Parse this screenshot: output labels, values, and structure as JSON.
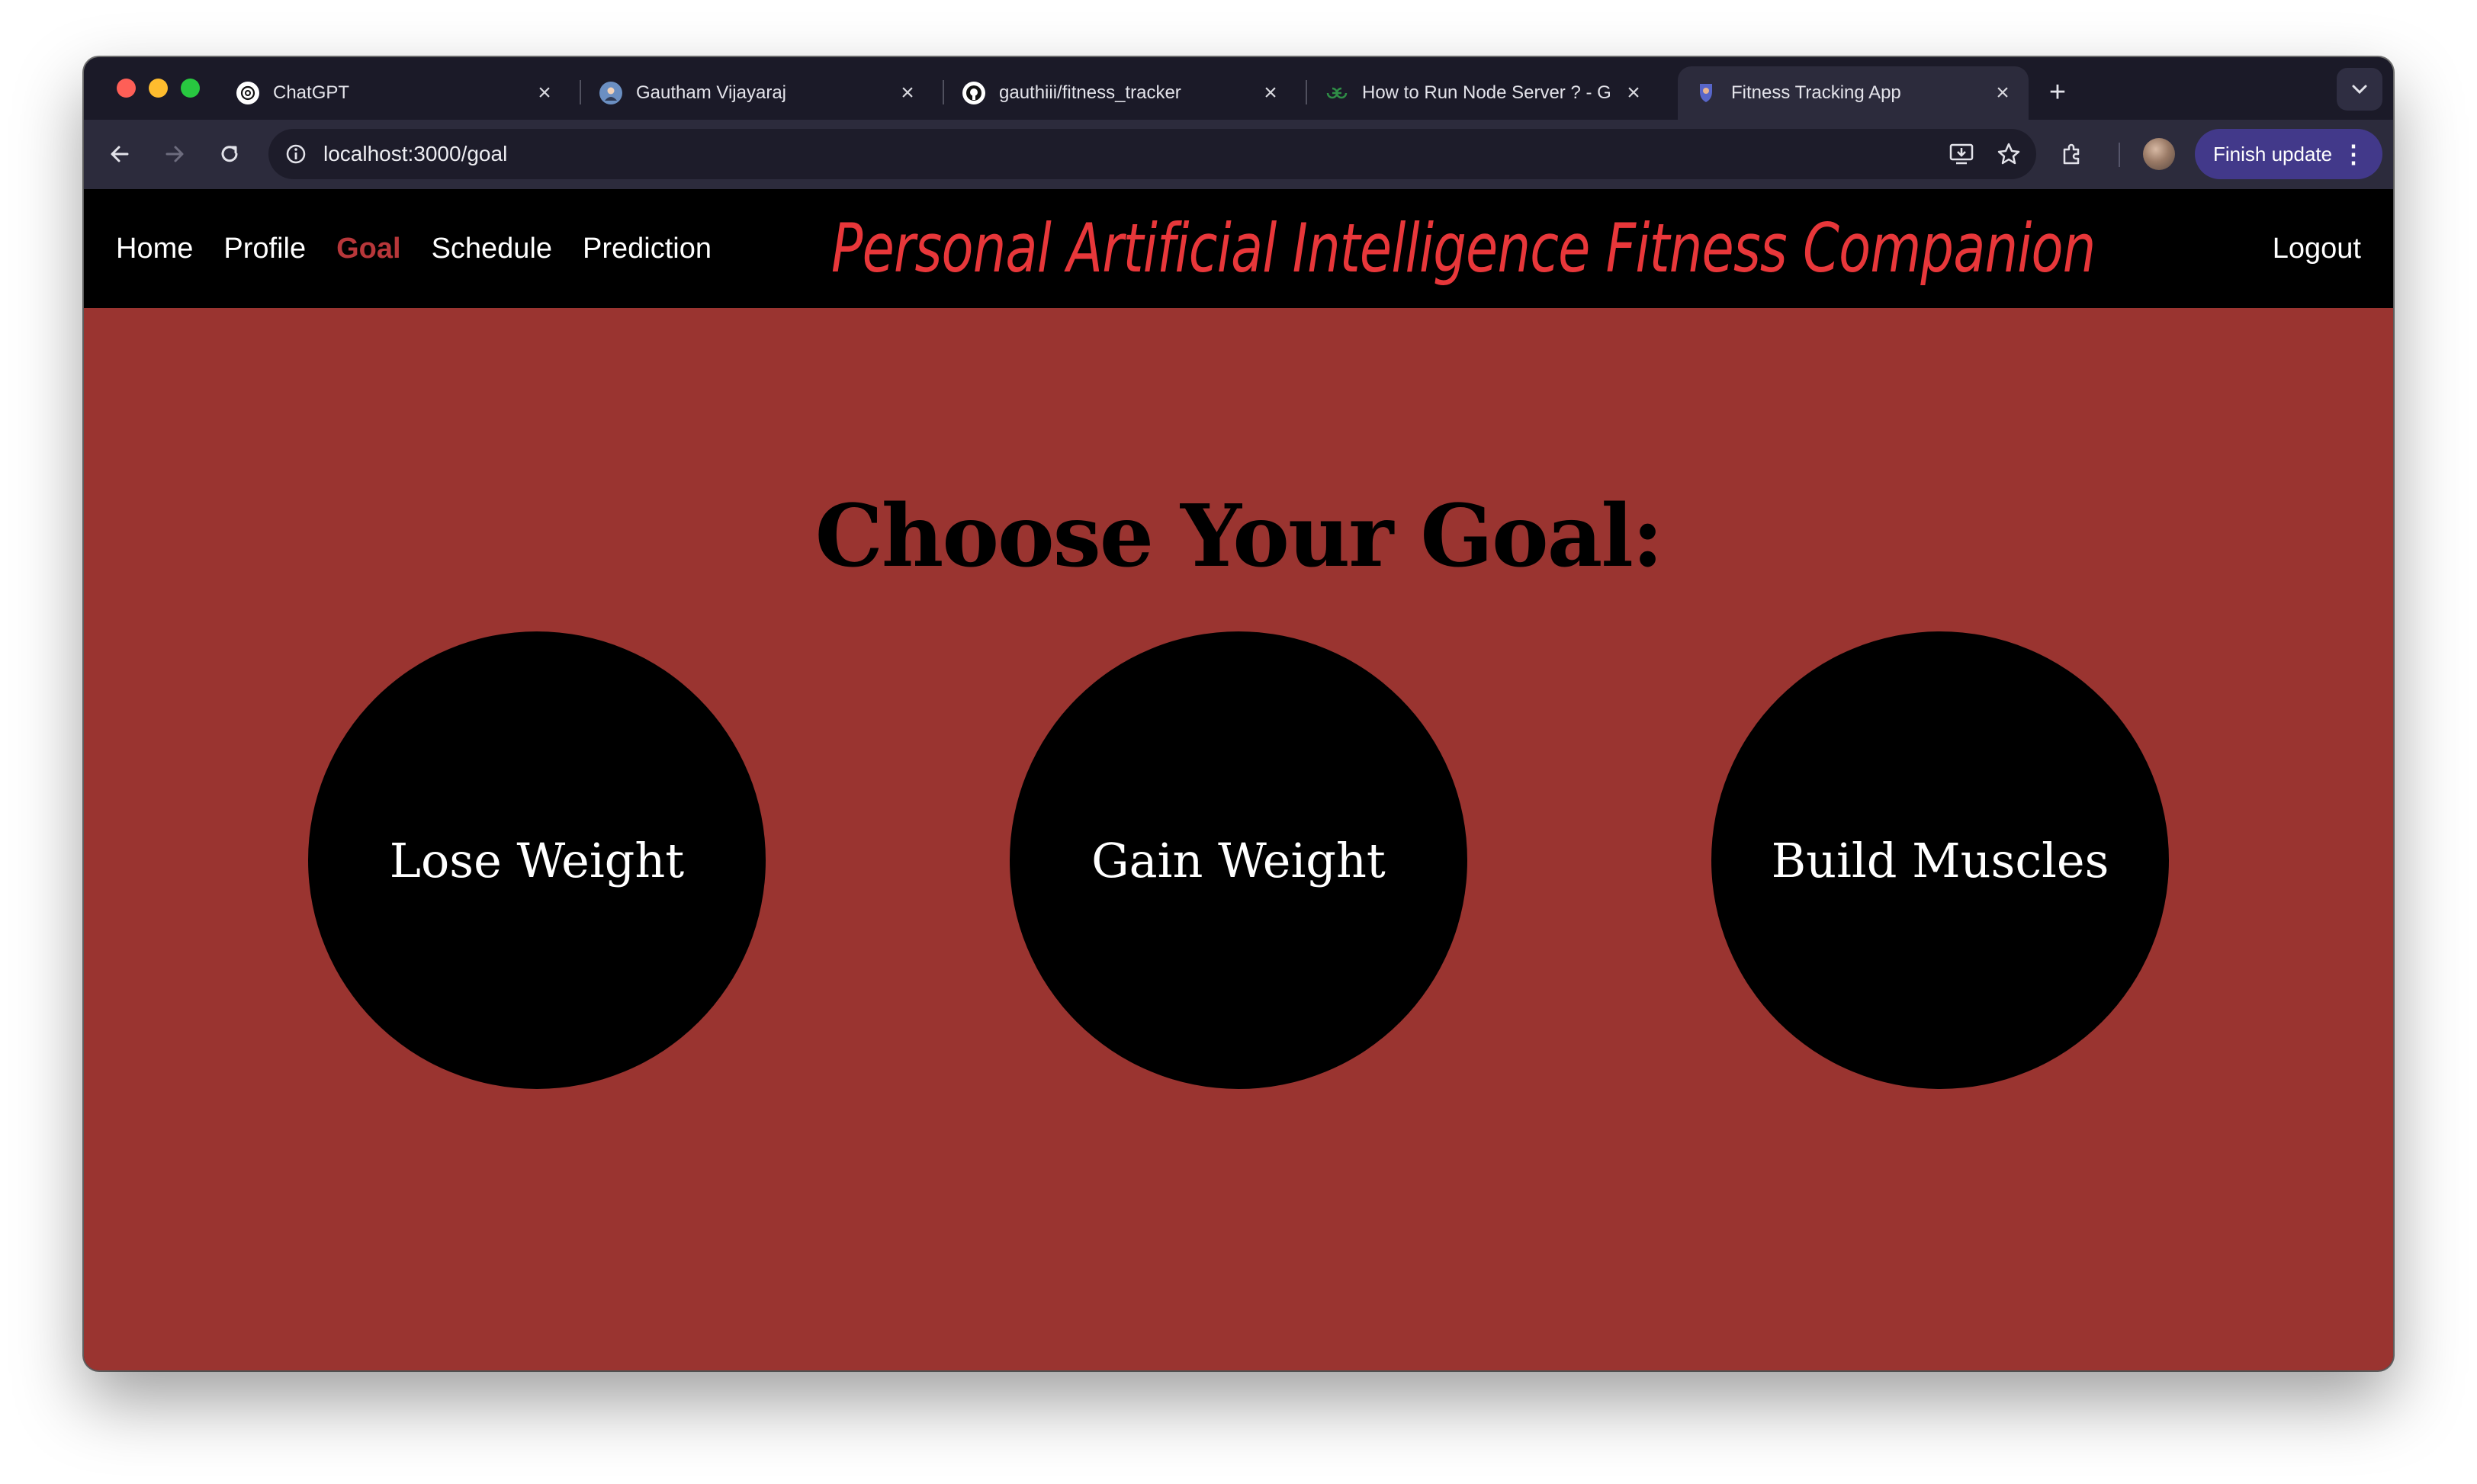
{
  "browser": {
    "tabs": [
      {
        "label": "ChatGPT",
        "icon": "chatgpt-icon"
      },
      {
        "label": "Gautham Vijayaraj",
        "icon": "profile-avatar-icon"
      },
      {
        "label": "gauthiii/fitness_tracker",
        "icon": "github-icon"
      },
      {
        "label": "How to Run Node Server ? - G",
        "icon": "geeksforgeeks-icon"
      },
      {
        "label": "Fitness Tracking App",
        "icon": "app-favicon-icon"
      }
    ],
    "active_tab": 4,
    "url": "localhost:3000/goal",
    "finish_update_label": "Finish update"
  },
  "app": {
    "nav": [
      {
        "label": "Home"
      },
      {
        "label": "Profile"
      },
      {
        "label": "Goal"
      },
      {
        "label": "Schedule"
      },
      {
        "label": "Prediction"
      }
    ],
    "active_nav": "Goal",
    "brand_title": "Personal Artificial Intelligence Fitness Companion",
    "logout_label": "Logout",
    "page_title": "Choose Your Goal:",
    "goals": [
      {
        "label": "Lose Weight"
      },
      {
        "label": "Gain Weight"
      },
      {
        "label": "Build Muscles"
      }
    ]
  },
  "colors": {
    "page_background": "#9a3430",
    "brand_red": "#e8373a",
    "active_nav": "#b8373a",
    "circle": "#000000"
  }
}
